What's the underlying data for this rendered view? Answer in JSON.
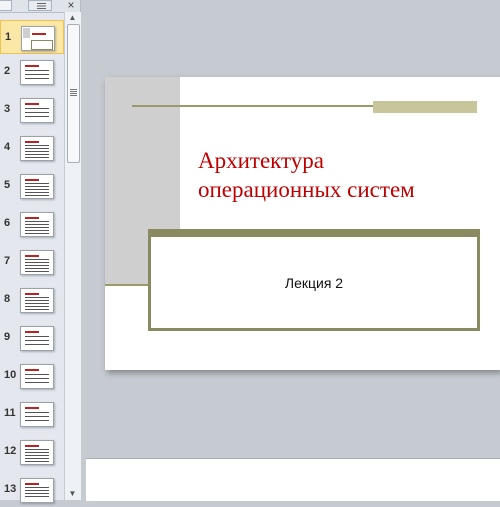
{
  "slides_panel": {
    "close_label": "×",
    "slide_numbers": [
      "1",
      "2",
      "3",
      "4",
      "5",
      "6",
      "7",
      "8",
      "9",
      "10",
      "11",
      "12",
      "13"
    ],
    "selected_slide": "1"
  },
  "slide": {
    "title_line1": "Архитектура",
    "title_line2": "операционных систем",
    "subtitle": "Лекция 2"
  },
  "colors": {
    "title": "#c00000",
    "accent": "#8a8a60",
    "selection": "#fbe7a6"
  }
}
